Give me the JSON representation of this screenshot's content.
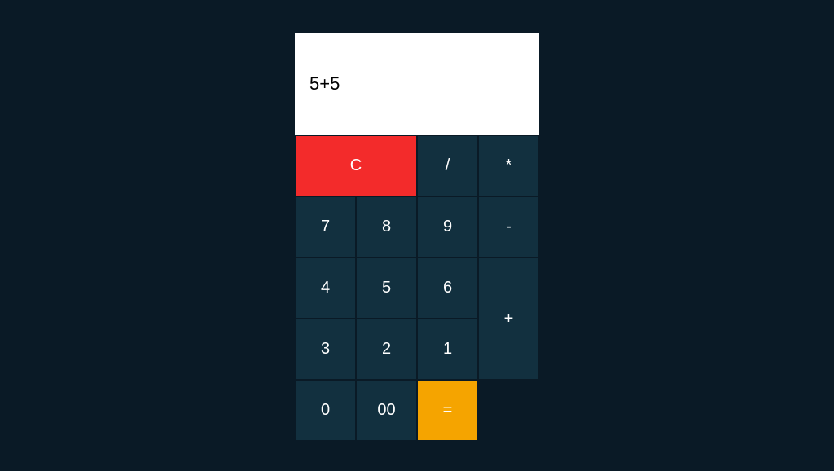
{
  "display": {
    "value": "5+5"
  },
  "buttons": {
    "clear": "C",
    "divide": "/",
    "multiply": "*",
    "minus": "-",
    "plus": "+",
    "equals": "=",
    "seven": "7",
    "eight": "8",
    "nine": "9",
    "four": "4",
    "five": "5",
    "six": "6",
    "three": "3",
    "two": "2",
    "one": "1",
    "zero": "0",
    "doublezero": "00"
  },
  "colors": {
    "background": "#0a1a26",
    "button": "#12303f",
    "clear": "#f32b2b",
    "equals": "#f5a400",
    "display": "#ffffff"
  }
}
